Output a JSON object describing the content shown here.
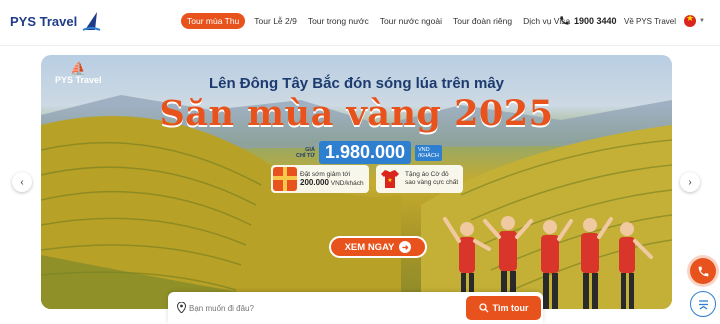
{
  "brand": {
    "name": "PYS Travel"
  },
  "nav": {
    "items": [
      {
        "label": "Tour mùa Thu",
        "active": true
      },
      {
        "label": "Tour Lễ 2/9"
      },
      {
        "label": "Tour trong nước"
      },
      {
        "label": "Tour nước ngoài"
      },
      {
        "label": "Tour đoàn riêng"
      },
      {
        "label": "Dịch vụ Visa"
      }
    ],
    "hotline": "1900 3440",
    "about": "Về PYS Travel",
    "language_flag": "vietnam-flag-icon"
  },
  "banner": {
    "logo_text": "PYS Travel",
    "kicker": "Lên Đông Tây Bắc đón sóng lúa trên mây",
    "headline": "Săn mùa vàng 2025",
    "price_label_1": "GIÁ",
    "price_label_2": "CHỈ TỪ",
    "price": "1.980.000",
    "price_unit_1": "VND",
    "price_unit_2": "/KHÁCH",
    "promo1_line1": "Đặt sớm giảm tới",
    "promo1_amount": "200.000",
    "promo1_unit": "VND/khách",
    "promo2_line1": "Tặng áo Cờ đỏ",
    "promo2_line2": "sao vàng cực chất",
    "cta": "XEM NGAY"
  },
  "search": {
    "placeholder": "Bạn muốn đi đâu?",
    "button": "Tìm tour"
  },
  "colors": {
    "accent": "#e8531d",
    "brand_blue": "#1f3c88",
    "price_blue": "#2f7fd1"
  }
}
